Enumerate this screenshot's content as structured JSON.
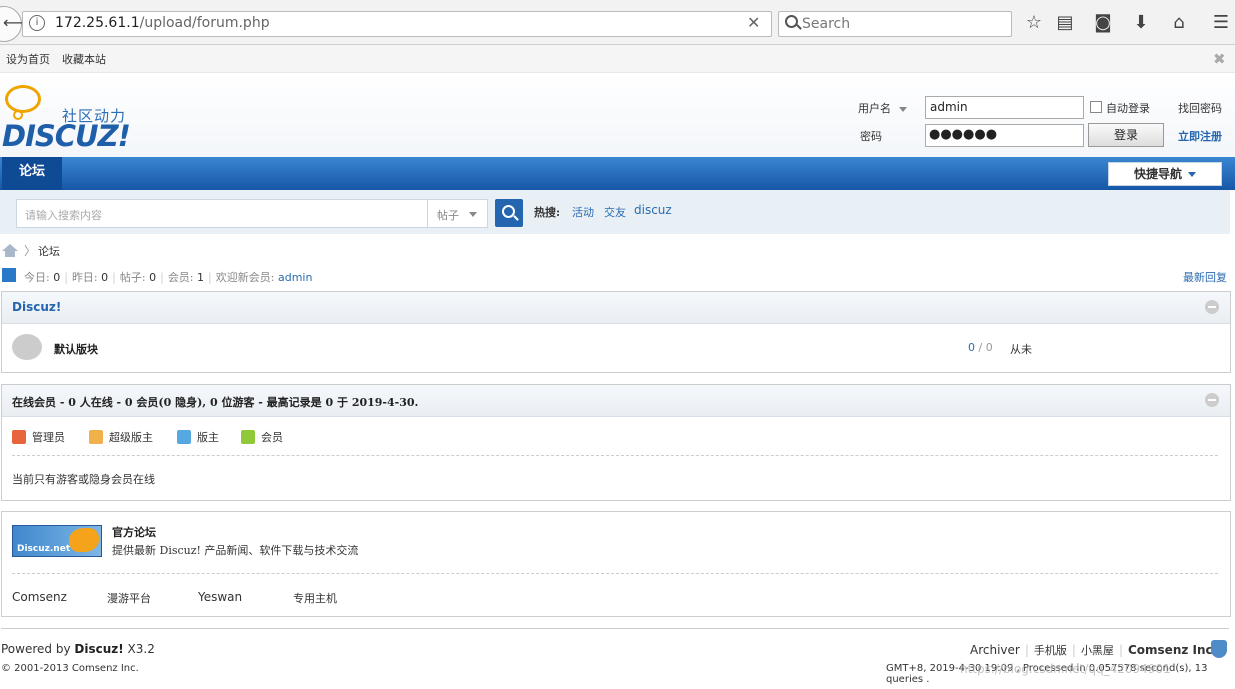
{
  "browser": {
    "url_host": "172.25.61.1",
    "url_path": "/upload/forum.php",
    "search_placeholder": "Search"
  },
  "sitebar": {
    "set_home": "设为首页",
    "bookmark": "收藏本站"
  },
  "logo": {
    "cn": "社区动力",
    "en": "DISCUZ!"
  },
  "login": {
    "username_label": "用户名",
    "username_value": "admin",
    "password_label": "密码",
    "password_value": "●●●●●●",
    "autologin": "自动登录",
    "login_button": "登录",
    "forgot": "找回密码",
    "register": "立即注册"
  },
  "nav": {
    "forum": "论坛",
    "quick_nav": "快捷导航"
  },
  "search": {
    "placeholder": "请输入搜索内容",
    "type": "帖子",
    "hot_label": "热搜:",
    "hot": [
      "活动",
      "交友",
      "discuz"
    ]
  },
  "breadcrumb": {
    "current": "论坛"
  },
  "stats": {
    "today_label": "今日:",
    "today": "0",
    "yesterday_label": "昨日:",
    "yesterday": "0",
    "posts_label": "帖子:",
    "posts": "0",
    "members_label": "会员:",
    "members": "1",
    "welcome_label": "欢迎新会员:",
    "newest": "admin",
    "latest_reply": "最新回复"
  },
  "category": {
    "title": "Discuz!",
    "forum_name": "默认版块",
    "threads": "0",
    "posts": "0",
    "last_post": "从未"
  },
  "online": {
    "title": "在线会员 - 0 人在线 - 0 会员(0 隐身), 0 位游客 - 最高记录是 0 于 2019-4-30.",
    "legend": [
      "管理员",
      "超级版主",
      "版主",
      "会员"
    ],
    "legend_colors": [
      "#e8643c",
      "#f0b04a",
      "#55a8e0",
      "#8fc93a"
    ],
    "message": "当前只有游客或隐身会员在线"
  },
  "links": {
    "banner_text": "Discuz.net",
    "official_title": "官方论坛",
    "official_desc": "提供最新 Discuz! 产品新闻、软件下载与技术交流",
    "items": [
      "Comsenz",
      "漫游平台",
      "Yeswan",
      "专用主机"
    ]
  },
  "footer": {
    "powered_prefix": "Powered by ",
    "powered_brand": "Discuz!",
    "powered_version": " X3.2",
    "copyright": "© 2001-2013 Comsenz Inc.",
    "links": [
      "Archiver",
      "手机版",
      "小黑屋",
      "Comsenz Inc."
    ],
    "time": "GMT+8, 2019-4-30 19:09 , Processed in 0.057578 second(s), 13 queries .",
    "watermark": "https://blog.csdn.net/qq_42094901"
  }
}
